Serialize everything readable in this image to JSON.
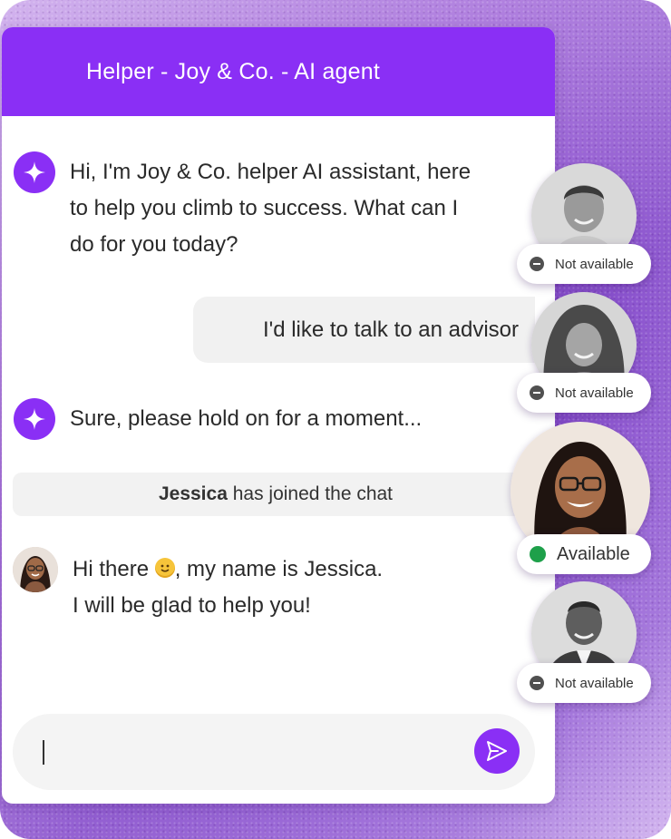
{
  "header": {
    "title": "Helper - Joy & Co. - AI agent"
  },
  "messages": {
    "bot_greeting_line1": "Hi, I'm Joy & Co. helper AI assistant, here",
    "bot_greeting_line2": "to help you climb to success. What can I",
    "bot_greeting_line3": "do for you today?",
    "user_request": "I'd like to talk to an advisor",
    "bot_hold": "Sure, please hold on for a moment...",
    "system_joined_name": "Jessica",
    "system_joined_text": " has joined the chat",
    "agent_line1_before": "Hi there ",
    "agent_line1_after": ", my name is Jessica.",
    "agent_line2": "I will be glad to help you!"
  },
  "composer": {
    "value": ""
  },
  "advisors": [
    {
      "status": "Not available"
    },
    {
      "status": "Not available"
    },
    {
      "status": "Available"
    },
    {
      "status": "Not available"
    }
  ],
  "colors": {
    "brand": "#8a2ff5",
    "available": "#1ea04a",
    "unavailable": "#505050"
  },
  "icons": {
    "bot": "sparkle-icon",
    "send": "send-icon",
    "emoji": "smiley-emoji-icon"
  }
}
